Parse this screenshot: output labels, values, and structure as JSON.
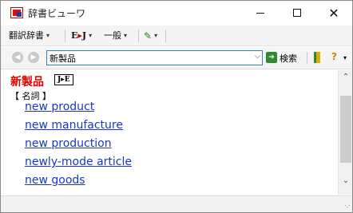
{
  "window": {
    "title": "辞書ビューワ",
    "controls": {
      "minimize": "—",
      "maximize": "☐",
      "close": "✕"
    }
  },
  "toolbar": {
    "dictionary_menu": "翻訳辞書",
    "ej_label_e": "E",
    "ej_label_arrow": "▸",
    "ej_label_j": "J",
    "general_menu": "一般",
    "caret": "▾"
  },
  "search": {
    "value": "新製品",
    "placeholder": "",
    "dropdown_glyph": "⌵",
    "button_label": "検索"
  },
  "result": {
    "headword": "新製品",
    "dictionary_badge": "J▸E",
    "part_of_speech": "【 名詞 】",
    "entries": [
      "new product",
      "new manufacture",
      "new production",
      "newly-mode article",
      "new goods"
    ]
  },
  "status": {
    "text": ""
  },
  "colors": {
    "headword": "#e00000",
    "link": "#1a36c8",
    "search_border": "#3c7fb1",
    "go_button": "#2e8b2e"
  },
  "icons": {
    "app": "dictionary-app-icon",
    "back": "back-arrow-icon",
    "forward": "forward-arrow-icon",
    "go": "go-arrow-icon",
    "book": "bookmark-icon",
    "help": "help-icon",
    "pen": "highlight-pen-icon",
    "grip": "resize-grip-icon"
  }
}
